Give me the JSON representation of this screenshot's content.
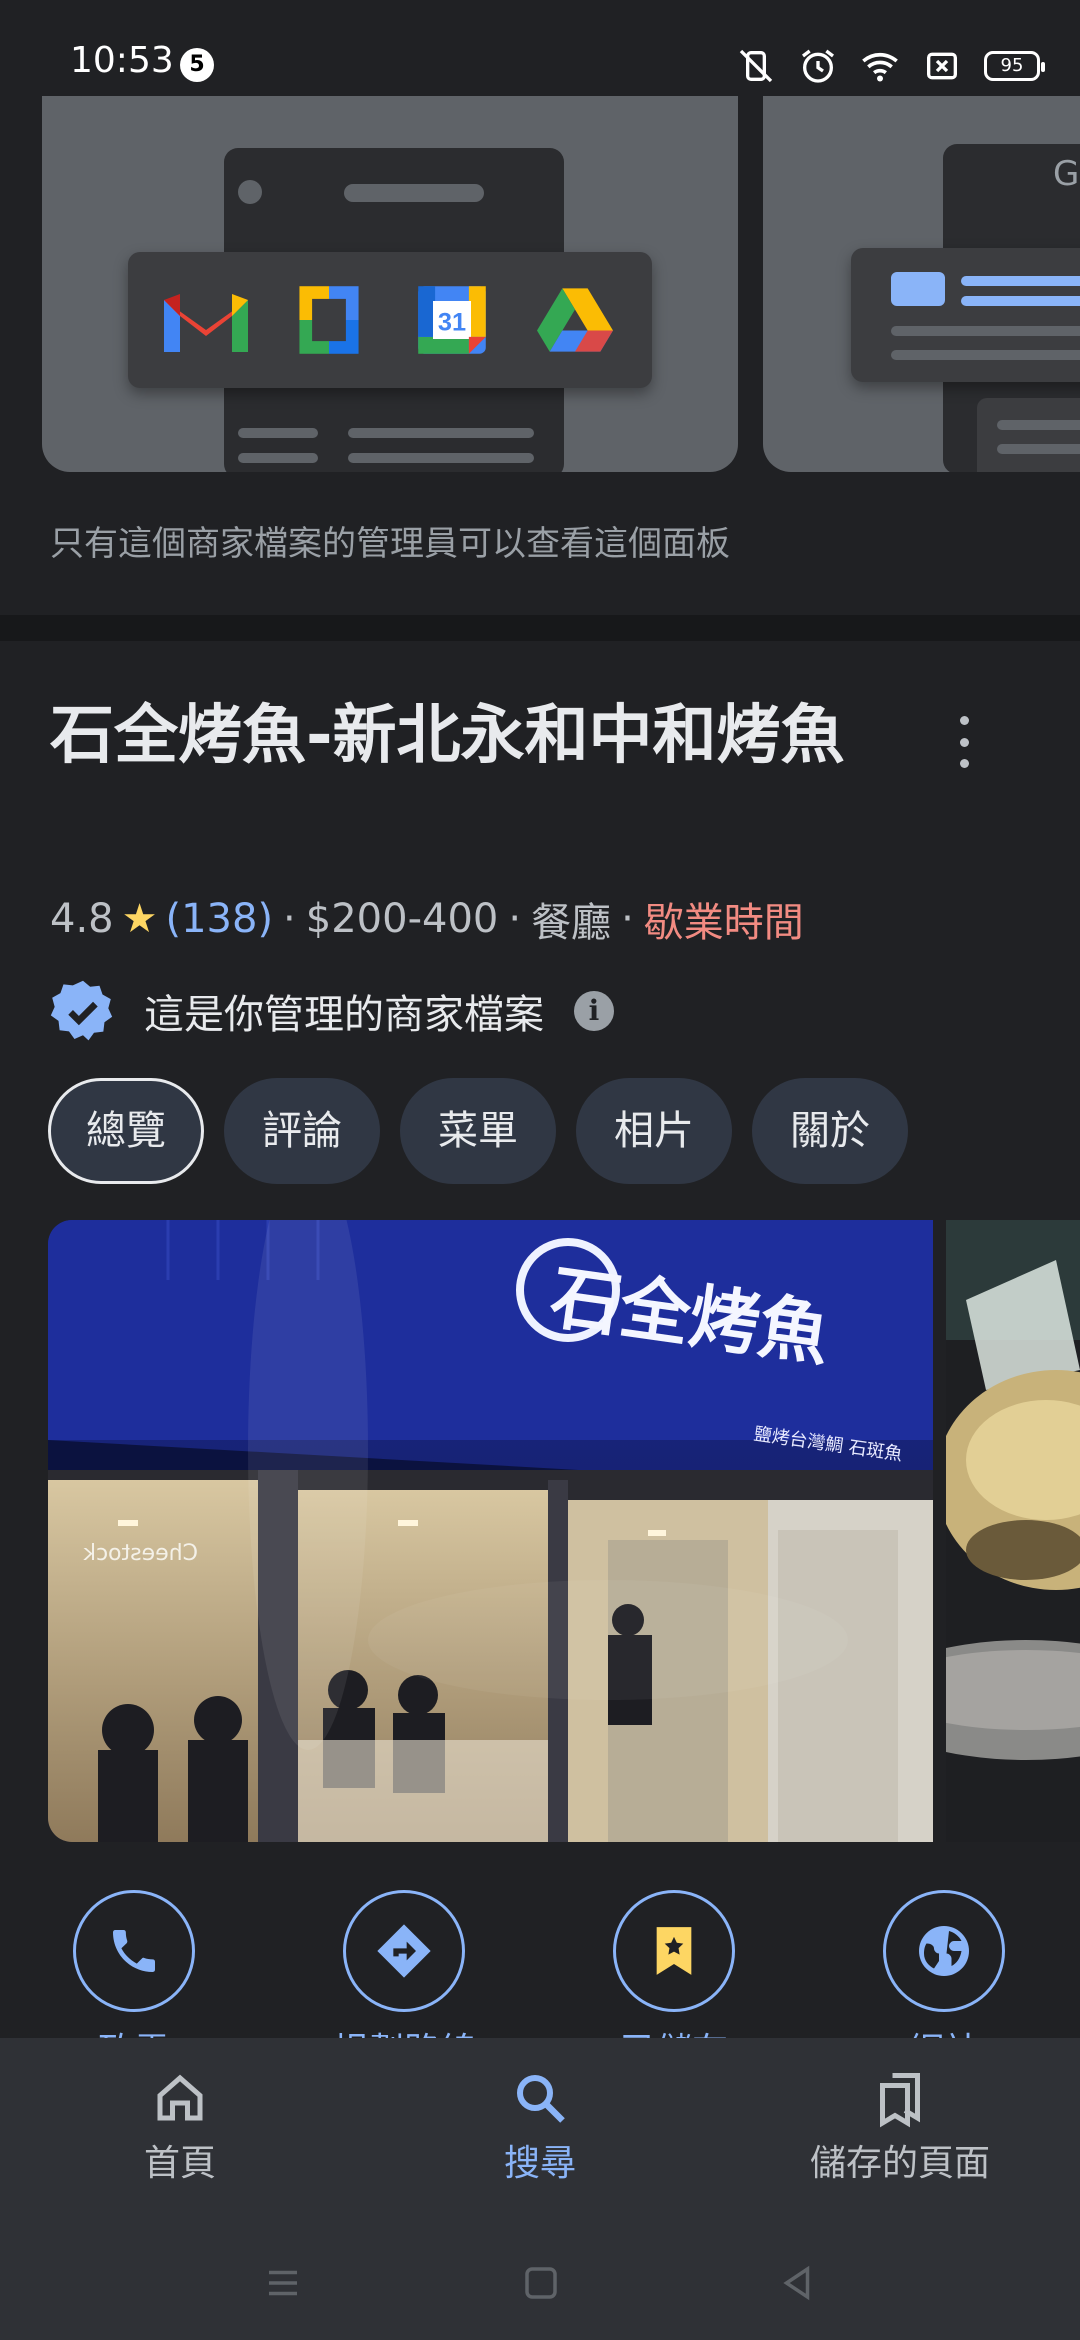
{
  "status_bar": {
    "time": "10:53",
    "notification_count": "5",
    "battery": "95",
    "icons": [
      "vibrate-off-icon",
      "alarm-icon",
      "wifi-icon",
      "sim-off-icon",
      "battery-icon"
    ]
  },
  "promo": {
    "card2_letter": "G",
    "apps": [
      "gmail-icon",
      "docs-icon",
      "calendar-icon",
      "drive-icon"
    ],
    "calendar_day": "31"
  },
  "admin_note": "只有這個商家檔案的管理員可以查看這個面板",
  "business": {
    "name": "石全烤魚-新北永和中和烤魚",
    "rating": "4.8",
    "reviews": "(138)",
    "price": "$200-400",
    "category": "餐廳",
    "hours": "歇業時間",
    "managed_text": "這是你管理的商家檔案"
  },
  "tabs": [
    {
      "label": "總覽",
      "active": true
    },
    {
      "label": "評論",
      "active": false
    },
    {
      "label": "菜單",
      "active": false
    },
    {
      "label": "相片",
      "active": false
    },
    {
      "label": "關於",
      "active": false
    }
  ],
  "photo": {
    "sign_text": "石全烤魚",
    "sub_sign": "鹽烤台灣鯛 石斑魚",
    "window_text": "Cheestock"
  },
  "actions": [
    {
      "label": "致電",
      "icon": "phone-icon"
    },
    {
      "label": "規劃路線",
      "icon": "directions-icon"
    },
    {
      "label": "已儲存",
      "icon": "bookmark-icon"
    },
    {
      "label": "網站",
      "icon": "globe-icon"
    }
  ],
  "bottom_nav": [
    {
      "label": "首頁",
      "icon": "home-icon",
      "active": false
    },
    {
      "label": "搜尋",
      "icon": "search-icon",
      "active": true
    },
    {
      "label": "儲存的頁面",
      "icon": "saved-icon",
      "active": false
    }
  ],
  "colors": {
    "background": "#202124",
    "accent": "#8ab4f8",
    "hours_red": "#f28b82",
    "star": "#fdd663",
    "verified": "#8ab4f8"
  }
}
